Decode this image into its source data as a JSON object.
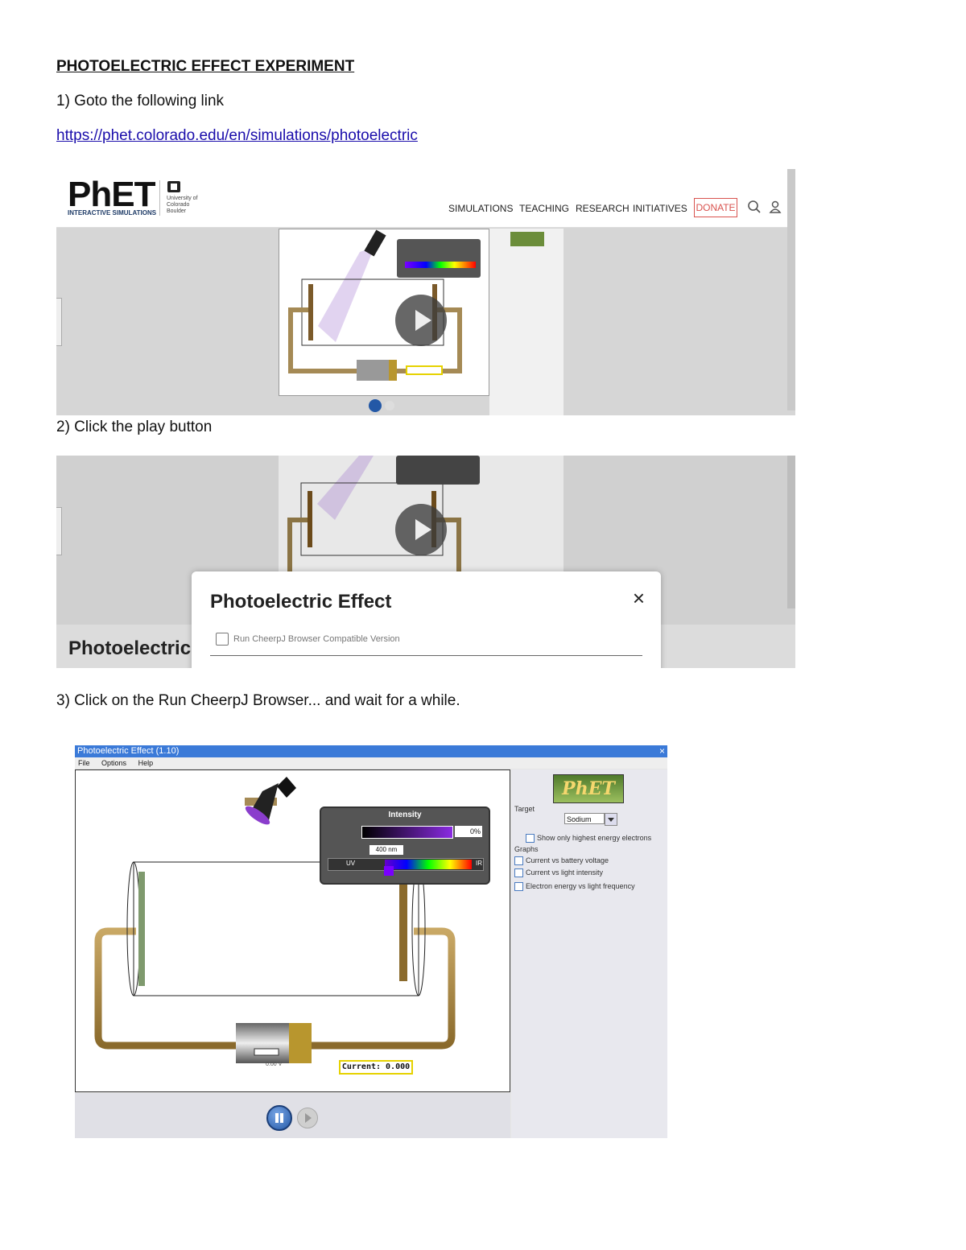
{
  "document": {
    "title": "PHOTOELECTRIC EFFECT EXPERIMENT",
    "step1": "1) Goto the following link",
    "link": "https://phet.colorado.edu/en/simulations/photoelectric",
    "step2": "2) Click the play button",
    "step3": "3) Click on the Run CheerpJ Browser... and wait for a while."
  },
  "screenshot1": {
    "logo_main": "PhET",
    "logo_sub": "INTERACTIVE SIMULATIONS",
    "university": "University of Colorado Boulder",
    "nav": [
      "SIMULATIONS",
      "TEACHING",
      "RESEARCH",
      "INITIATIVES"
    ],
    "donate": "DONATE",
    "icons": [
      "search-icon",
      "user-icon",
      "play-icon"
    ],
    "accent_color": "#d9534f"
  },
  "screenshot2": {
    "modal_title": "Photoelectric Effect",
    "modal_close": "×",
    "modal_option": "Run CheerpJ Browser Compatible Version",
    "page_title": "Photoelectric"
  },
  "screenshot3": {
    "window_title": "Photoelectric Effect (1.10)",
    "close": "×",
    "menu": [
      "File",
      "Options",
      "Help"
    ],
    "intensity_label": "Intensity",
    "intensity_value": "0%",
    "wavelength": "400 nm",
    "uv_label": "UV",
    "ir_label": "IR",
    "current_label": "Current:  0.000",
    "battery_voltage": "0.00 V",
    "phet_logo": "PhET",
    "target_label": "Target",
    "target_value": "Sodium",
    "show_highest": "Show only highest energy electrons",
    "graphs_label": "Graphs",
    "graph_options": [
      "Current vs battery voltage",
      "Current vs light intensity",
      "Electron energy vs light frequency"
    ]
  }
}
